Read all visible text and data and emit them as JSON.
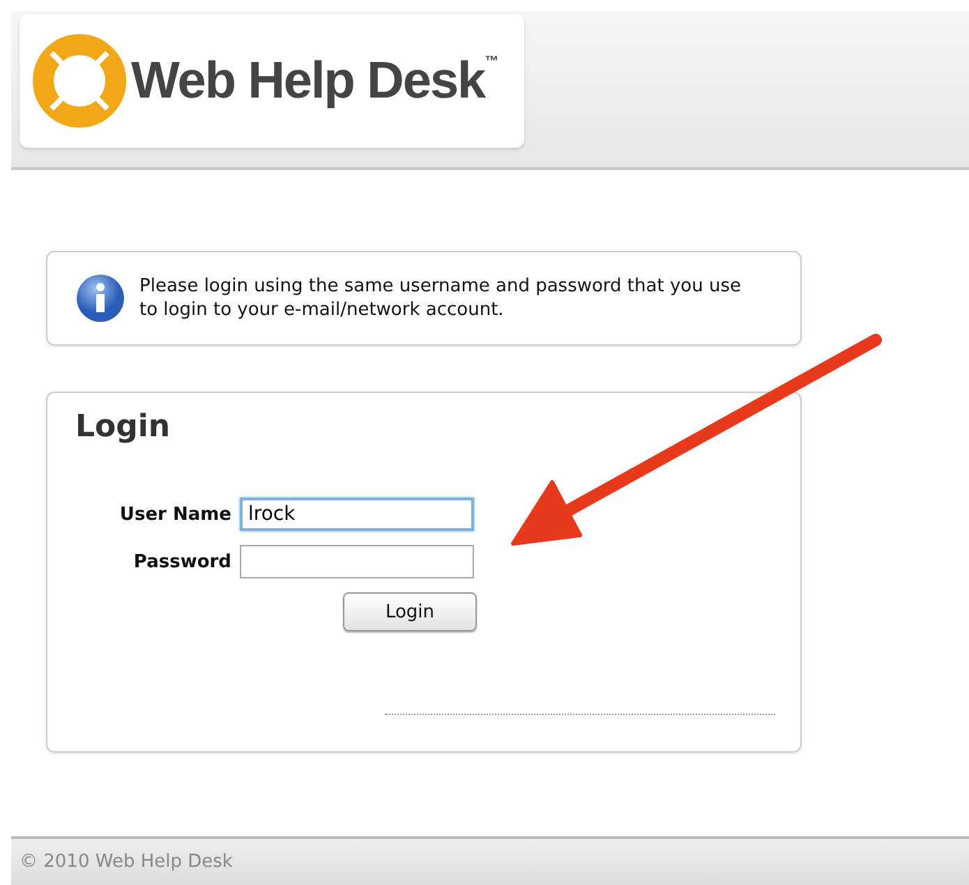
{
  "header": {
    "logo_text": "Web Help Desk",
    "trademark": "™"
  },
  "notice": {
    "text": "Please login using the same username and password that you use to login to your e-mail/network account."
  },
  "login": {
    "title": "Login",
    "fields": [
      {
        "label": "User Name",
        "value": "lrock",
        "focused": true
      },
      {
        "label": "Password",
        "focused": false
      }
    ],
    "button": "Login"
  },
  "footer": {
    "text": "© 2010 Web Help Desk"
  }
}
